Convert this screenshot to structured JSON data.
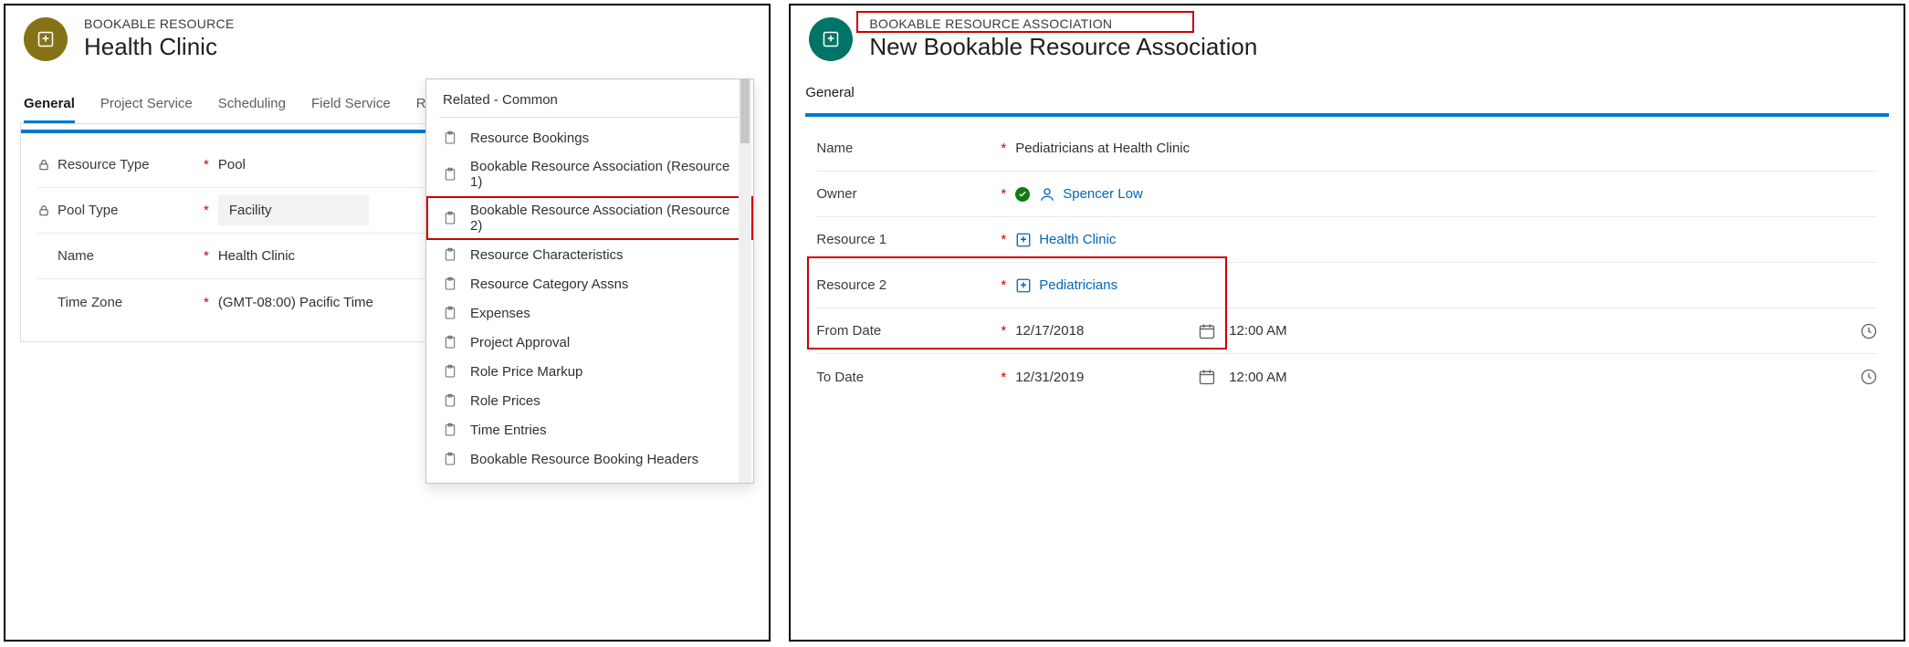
{
  "left": {
    "entityLabel": "BOOKABLE RESOURCE",
    "title": "Health Clinic",
    "tabs": [
      "General",
      "Project Service",
      "Scheduling",
      "Field Service",
      "Related"
    ],
    "activeTab": "General",
    "fields": {
      "resourceType": {
        "label": "Resource Type",
        "value": "Pool",
        "locked": true
      },
      "poolType": {
        "label": "Pool Type",
        "value": "Facility",
        "locked": true
      },
      "name": {
        "label": "Name",
        "value": "Health Clinic"
      },
      "timeZone": {
        "label": "Time Zone",
        "value": "(GMT-08:00) Pacific Time"
      }
    },
    "related": {
      "header": "Related - Common",
      "items": [
        "Resource Bookings",
        "Bookable Resource Association (Resource 1)",
        "Bookable Resource Association (Resource 2)",
        "Resource Characteristics",
        "Resource Category Assns",
        "Expenses",
        "Project Approval",
        "Role Price Markup",
        "Role Prices",
        "Time Entries",
        "Bookable Resource Booking Headers"
      ],
      "highlightedIndex": 2
    }
  },
  "right": {
    "entityLabel": "BOOKABLE RESOURCE ASSOCIATION",
    "title": "New Bookable Resource Association",
    "tab": "General",
    "fields": {
      "name": {
        "label": "Name",
        "value": "Pediatricians at Health Clinic"
      },
      "owner": {
        "label": "Owner",
        "value": "Spencer Low"
      },
      "res1": {
        "label": "Resource 1",
        "value": "Health Clinic"
      },
      "res2": {
        "label": "Resource 2",
        "value": "Pediatricians"
      },
      "fromDate": {
        "label": "From Date",
        "date": "12/17/2018",
        "time": "12:00 AM"
      },
      "toDate": {
        "label": "To Date",
        "date": "12/31/2019",
        "time": "12:00 AM"
      }
    }
  }
}
